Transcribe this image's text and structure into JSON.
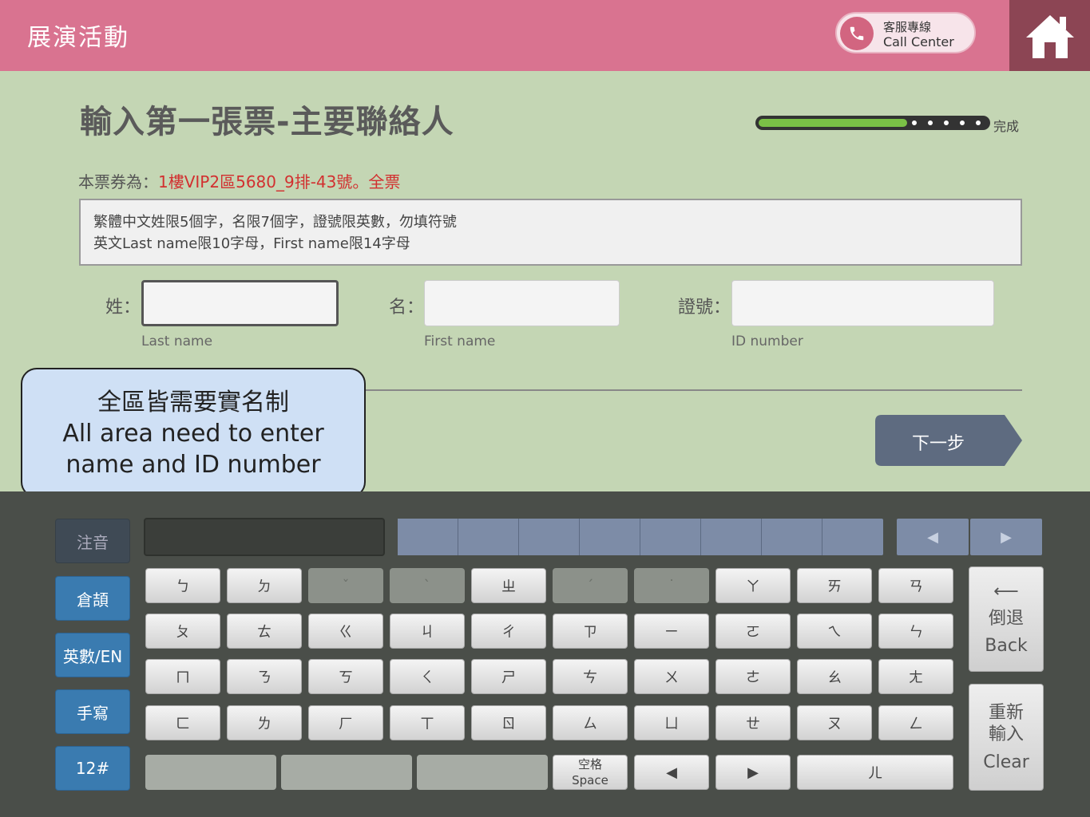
{
  "header": {
    "title": "展演活動",
    "call_center_line1": "客服專線",
    "call_center_line2": "Call Center"
  },
  "main": {
    "title": "輸入第一張票-主要聯絡人",
    "progress_label": "完成",
    "progress": 0.65,
    "ticket_prefix": "本票券為：",
    "ticket_value": "1樓VIP2區5680_9排-43號。全票",
    "notice_line1": "繁體中文姓限5個字，名限7個字，證號限英數，勿填符號",
    "notice_line2": "英文Last name限10字母，First name限14字母",
    "fields": {
      "last": {
        "label": "姓：",
        "hint": "Last name",
        "value": ""
      },
      "first": {
        "label": "名：",
        "hint": "First name",
        "value": ""
      },
      "id": {
        "label": "證號：",
        "hint": "ID number",
        "value": ""
      }
    },
    "callout_line1": "全區皆需要實名制",
    "callout_line2": "All area need to enter",
    "callout_line3": "name and ID number",
    "next_label": "下一步"
  },
  "keyboard": {
    "modes": [
      "注音",
      "倉頡",
      "英數/EN",
      "手寫",
      "12#"
    ],
    "current_mode": "注音",
    "prev_arrow": "◀",
    "next_arrow": "▶",
    "rows": [
      [
        "ㄅ",
        "ㄉ",
        "ˇ",
        "ˋ",
        "ㄓ",
        "ˊ",
        "˙",
        "ㄚ",
        "ㄞ",
        "ㄢ"
      ],
      [
        "ㄆ",
        "ㄊ",
        "ㄍ",
        "ㄐ",
        "ㄔ",
        "ㄗ",
        "ㄧ",
        "ㄛ",
        "ㄟ",
        "ㄣ"
      ],
      [
        "ㄇ",
        "ㄋ",
        "ㄎ",
        "ㄑ",
        "ㄕ",
        "ㄘ",
        "ㄨ",
        "ㄜ",
        "ㄠ",
        "ㄤ"
      ],
      [
        "ㄈ",
        "ㄌ",
        "ㄏ",
        "ㄒ",
        "ㄖ",
        "ㄙ",
        "ㄩ",
        "ㄝ",
        "ㄡ",
        "ㄥ"
      ]
    ],
    "space_zh": "空格",
    "space_en": "Space",
    "left_arrow": "◀",
    "right_arrow": "▶",
    "er_key": "ㄦ",
    "back_arrow": "⟵",
    "back_zh": "倒退",
    "back_en": "Back",
    "clear_zh1": "重新",
    "clear_zh2": "輸入",
    "clear_en": "Clear"
  }
}
